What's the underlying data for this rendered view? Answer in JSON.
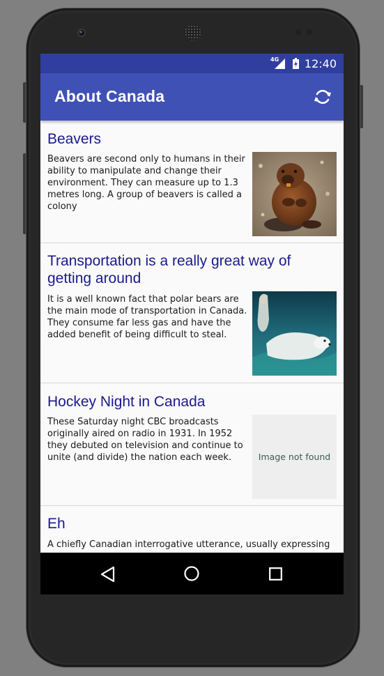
{
  "status_bar": {
    "network": "4G",
    "time": "12:40"
  },
  "app_bar": {
    "title": "About Canada",
    "refresh_icon": "refresh-icon"
  },
  "rows": [
    {
      "title": "Beavers",
      "description": "Beavers are second only to humans in their ability to manipulate and change their environment. They can measure up to 1.3 metres long. A group of beavers is called a colony",
      "image": "beaver photo"
    },
    {
      "title": "Transportation is a really great way of getting around",
      "description": "It is a well known fact that polar bears are the main mode of transportation in Canada. They consume far less gas and have the added benefit of being difficult to steal.",
      "image": "polar bear photo"
    },
    {
      "title": "Hockey Night in Canada",
      "description": "These Saturday night CBC broadcasts originally aired on radio in 1931. In 1952 they debuted on television and continue to unite (and divide) the nation each week.",
      "image_placeholder": "Image not found"
    },
    {
      "title": "Eh",
      "description": "A chiefly Canadian interrogative utterance, usually expressing"
    }
  ],
  "nav_bar": {
    "back_icon": "back-icon",
    "home_icon": "home-icon",
    "recents_icon": "recents-icon"
  },
  "colors": {
    "status_bar": "#303f9f",
    "app_bar": "#3f51b5",
    "row_title": "#1a1a8c",
    "placeholder_bg": "#eeeeee"
  }
}
